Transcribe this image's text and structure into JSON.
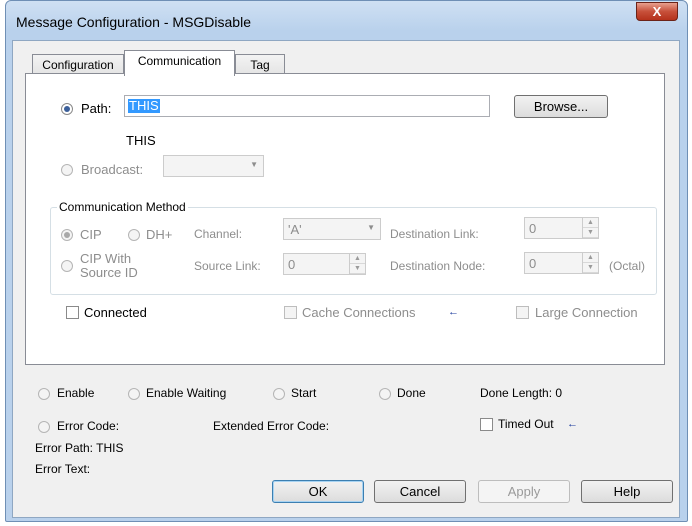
{
  "window": {
    "title": "Message Configuration - MSGDisable",
    "close_label": "X"
  },
  "tabs": [
    {
      "label": "Configuration",
      "active": false
    },
    {
      "label": "Communication",
      "active": true
    },
    {
      "label": "Tag",
      "active": false
    }
  ],
  "path": {
    "label": "Path:",
    "value": "THIS",
    "resolved": "THIS",
    "browse_label": "Browse..."
  },
  "broadcast": {
    "label": "Broadcast:",
    "value": ""
  },
  "comm_method": {
    "group_label": "Communication Method",
    "cip_label": "CIP",
    "dhplus_label": "DH+",
    "cip_with_source_label_1": "CIP With",
    "cip_with_source_label_2": "Source ID",
    "channel_label": "Channel:",
    "channel_value": "'A'",
    "source_link_label": "Source Link:",
    "source_link_value": "0",
    "dest_link_label": "Destination Link:",
    "dest_link_value": "0",
    "dest_node_label": "Destination Node:",
    "dest_node_value": "0",
    "octal_label": "(Octal)"
  },
  "options": {
    "connected_label": "Connected",
    "cache_label": "Cache Connections",
    "large_label": "Large Connection",
    "cache_arrow": "←"
  },
  "status": {
    "enable": "Enable",
    "enable_waiting": "Enable Waiting",
    "start": "Start",
    "done": "Done",
    "done_length": "Done Length: 0",
    "error_code": "Error Code:",
    "extended_error_code": "Extended Error Code:",
    "timed_out": "Timed Out",
    "timed_out_arrow": "←",
    "error_path": "Error Path: THIS",
    "error_text": "Error Text:"
  },
  "buttons": {
    "ok": "OK",
    "cancel": "Cancel",
    "apply": "Apply",
    "help": "Help"
  }
}
